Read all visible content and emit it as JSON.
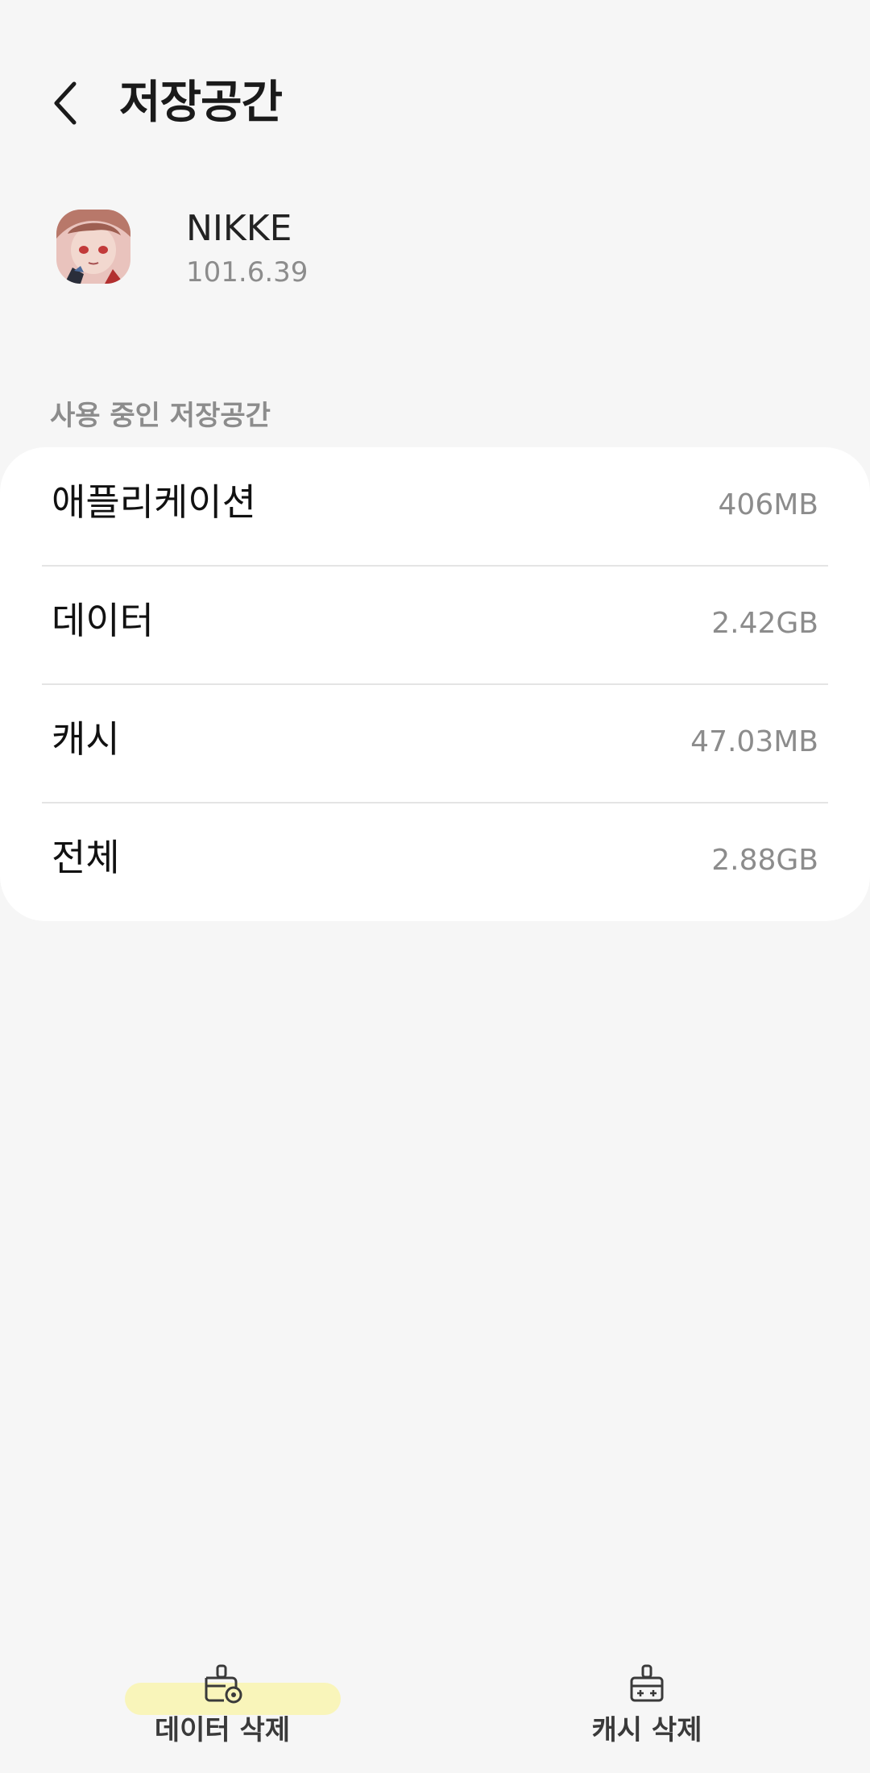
{
  "header": {
    "title": "저장공간"
  },
  "app": {
    "name": "NIKKE",
    "version": "101.6.39"
  },
  "storage": {
    "section_title": "사용 중인 저장공간",
    "rows": [
      {
        "label": "애플리케이션",
        "value": "406MB"
      },
      {
        "label": "데이터",
        "value": "2.42GB"
      },
      {
        "label": "캐시",
        "value": "47.03MB"
      },
      {
        "label": "전체",
        "value": "2.88GB"
      }
    ]
  },
  "actions": {
    "clear_data": {
      "label": "데이터 삭제",
      "icon": "clear-data-icon"
    },
    "clear_cache": {
      "label": "캐시 삭제",
      "icon": "clear-cache-icon"
    }
  },
  "colors": {
    "background": "#f6f6f6",
    "card": "#ffffff",
    "secondary_text": "#8c8c8c",
    "highlight": "#faf5b4"
  }
}
